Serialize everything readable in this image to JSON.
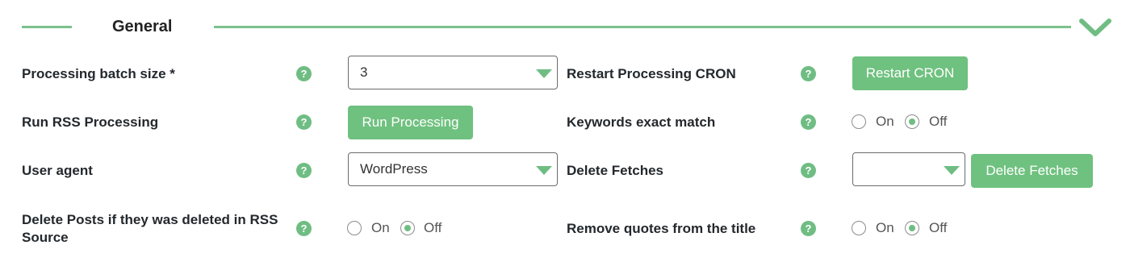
{
  "section": {
    "title": "General"
  },
  "rows": {
    "batch_size": {
      "label": "Processing batch size *",
      "value": "3"
    },
    "restart_cron": {
      "label": "Restart Processing CRON",
      "button": "Restart CRON"
    },
    "run_rss": {
      "label": "Run RSS Processing",
      "button": "Run Processing"
    },
    "keywords_exact": {
      "label": "Keywords exact match",
      "on": "On",
      "off": "Off",
      "selected": "Off"
    },
    "user_agent": {
      "label": "User agent",
      "value": "WordPress"
    },
    "delete_fetches": {
      "label": "Delete Fetches",
      "value": "",
      "button": "Delete Fetches"
    },
    "delete_posts": {
      "label_line1": "Delete Posts if they was deleted in RSS",
      "label_line2": "Source",
      "on": "On",
      "off": "Off",
      "selected": "Off"
    },
    "remove_quotes": {
      "label": "Remove quotes from the title",
      "on": "On",
      "off": "Off",
      "selected": "Off"
    }
  },
  "help_glyph": "?",
  "colors": {
    "accent": "#6fc17f",
    "line": "#7cc18d",
    "text": "#23282d"
  },
  "icons": {
    "collapse": "chevron-down-icon",
    "help": "question-mark-icon"
  }
}
